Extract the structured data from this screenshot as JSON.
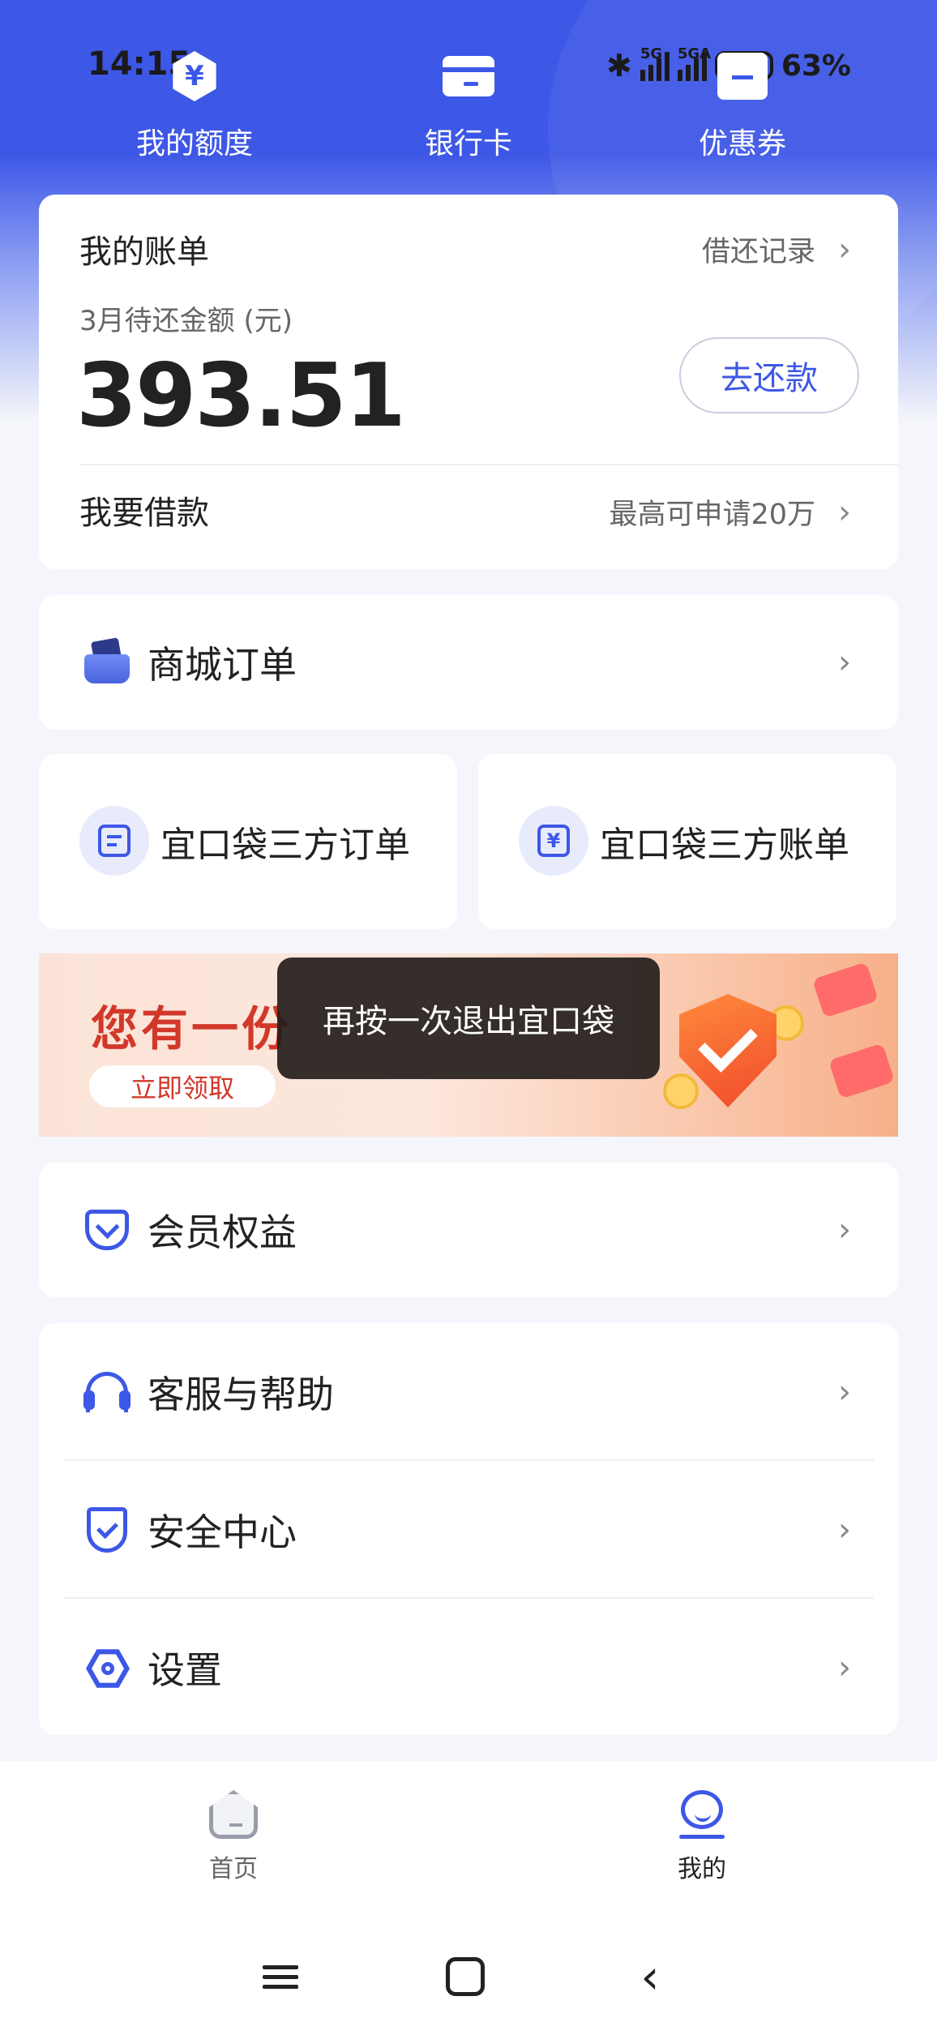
{
  "status": {
    "time": "14:15",
    "network1": "5G",
    "network2": "5GA",
    "battery": "63%"
  },
  "quick": [
    {
      "label": "我的额度",
      "icon": "yen-hexagon-icon"
    },
    {
      "label": "银行卡",
      "icon": "bank-card-icon"
    },
    {
      "label": "优惠券",
      "icon": "coupon-icon"
    }
  ],
  "bill": {
    "title": "我的账单",
    "record_link": "借还记录",
    "subtitle": "3月待还金额 (元)",
    "amount": "393.51",
    "repay_button": "去还款",
    "borrow_label": "我要借款",
    "borrow_hint": "最高可申请20万"
  },
  "mall_orders": {
    "label": "商城订单"
  },
  "third_party": {
    "orders": "宜口袋三方订单",
    "bills": "宜口袋三方账单"
  },
  "banner": {
    "title": "您有一份",
    "button": "立即领取"
  },
  "toast": "再按一次退出宜口袋",
  "member": {
    "label": "会员权益"
  },
  "menu": [
    {
      "label": "客服与帮助",
      "icon": "headset-icon"
    },
    {
      "label": "安全中心",
      "icon": "shield-icon"
    },
    {
      "label": "设置",
      "icon": "settings-hexagon-icon"
    }
  ],
  "tabs": [
    {
      "label": "首页",
      "active": false
    },
    {
      "label": "我的",
      "active": true
    }
  ],
  "colors": {
    "primary": "#3d57e6",
    "background": "#f5f6fb",
    "banner_red": "#d2382a"
  }
}
